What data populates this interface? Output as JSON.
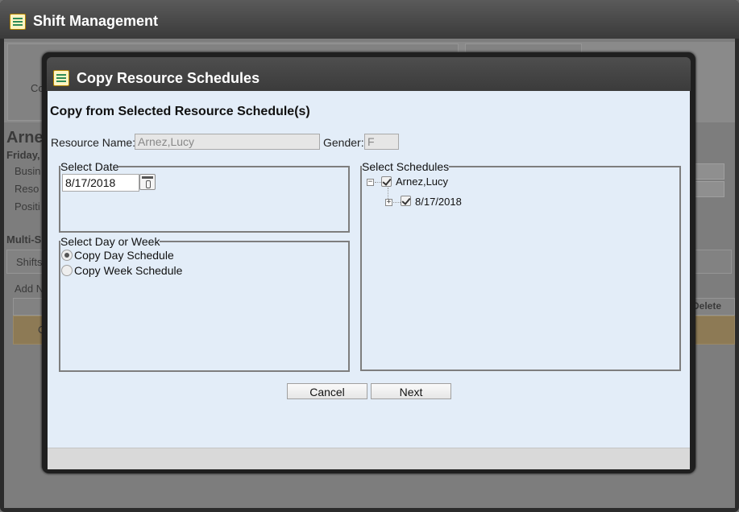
{
  "app": {
    "title": "Shift Management"
  },
  "background": {
    "name_partial": "Arne",
    "day_partial": "Friday,",
    "field_labels": [
      "Busin",
      "Reso",
      "Positi"
    ],
    "section_partial": "Multi-S",
    "tab_partial": "Shifts",
    "add_partial": "Add N",
    "tab_label_partial": "Co",
    "col_delete": "Delete",
    "row_partial": "C"
  },
  "dialog": {
    "title": "Copy Resource Schedules",
    "heading": "Copy from Selected Resource Schedule(s)",
    "resource_name_label": "Resource Name:",
    "resource_name_value": "Arnez,Lucy",
    "gender_label": "Gender:",
    "gender_value": "F",
    "select_date": {
      "legend": "Select Date",
      "value": "8/17/2018"
    },
    "select_day_week": {
      "legend": "Select Day or Week",
      "options": [
        {
          "label": "Copy Day Schedule",
          "checked": true
        },
        {
          "label": "Copy Week Schedule",
          "checked": false
        }
      ]
    },
    "select_schedules": {
      "legend": "Select Schedules",
      "tree": {
        "label": "Arnez,Lucy",
        "expander": "−",
        "checked": true,
        "children": [
          {
            "label": "8/17/2018",
            "expander": "+",
            "checked": true
          }
        ]
      }
    },
    "buttons": {
      "cancel": "Cancel",
      "next": "Next"
    }
  }
}
